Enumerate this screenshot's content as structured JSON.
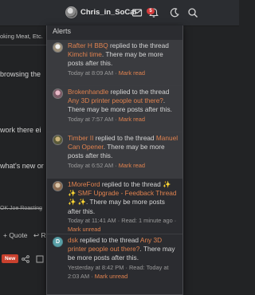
{
  "topbar": {
    "username": "Chris_in_SoCal",
    "alert_count": "5"
  },
  "background": {
    "crumb": "oking Meat, Etc.",
    "line1": "browsing the",
    "line2": "work there ei",
    "line3": "what's new or",
    "strike": "OK Joe Roasting",
    "quote_label": "+ Quote",
    "reply_label": "↩ R",
    "new_tag": "New"
  },
  "popup": {
    "title": "Alerts",
    "alerts": [
      {
        "user": "Rafter H BBQ",
        "verb": "replied to the thread",
        "thread": "Kimchi time",
        "rest": ". There may be more posts after this.",
        "time": "Today at 8:09 AM",
        "sep": " · ",
        "action": "Mark read"
      },
      {
        "user": "Brokenhandle",
        "verb": "replied to the thread",
        "thread": "Any 3D printer people out there?",
        "rest": ". There may be more posts after this.",
        "time": "Today at 7:57 AM",
        "sep": " · ",
        "action": "Mark read"
      },
      {
        "user": "Timber II",
        "verb": "replied to the thread",
        "thread": "Manuel Can Opener",
        "rest": ". There may be more posts after this.",
        "time": "Today at 6:52 AM",
        "sep": " · ",
        "action": "Mark read"
      },
      {
        "user": "1MoreFord",
        "verb": "replied to the thread",
        "thread": "✨ ✨ SMF Upgrade - Feedback Thread ✨ ✨",
        "rest": ". There may be more posts after this.",
        "time": "Today at 11:41 AM",
        "read": " · Read: 1 minute ago · ",
        "action": "Mark unread"
      },
      {
        "user": "dsk",
        "verb": "replied to the thread",
        "thread": "Any 3D printer people out there?",
        "rest": ". There may be more posts after this.",
        "time": "Yesterday at 8:42 PM",
        "read": " · Read: Today at 2:03 AM · ",
        "action": "Mark unread"
      }
    ]
  }
}
